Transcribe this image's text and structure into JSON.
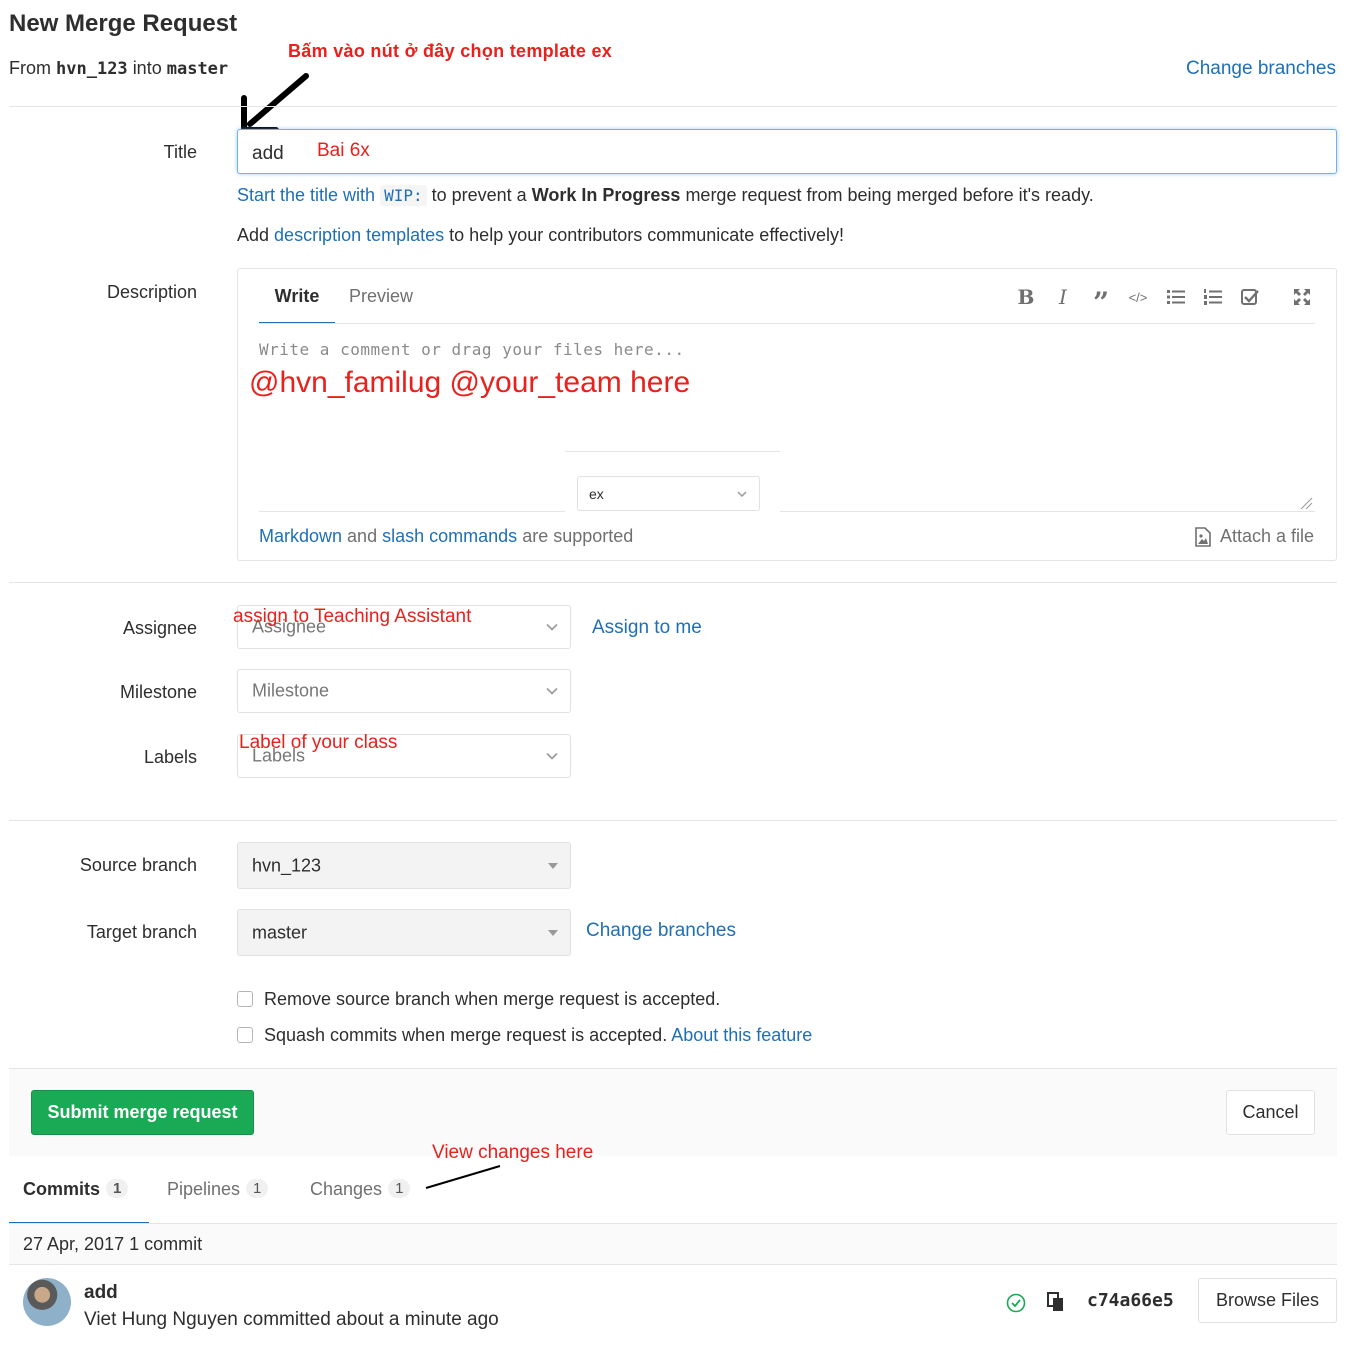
{
  "header": {
    "title": "New Merge Request",
    "from_word": "From",
    "source_branch": "hvn_123",
    "into_word": "into",
    "target_branch": "master",
    "change_branches": "Change branches"
  },
  "annotations": {
    "template_hint": "Bấm vào nút ở đây chọn template ex",
    "title_hint": "Bai 6x",
    "mentions": "@hvn_familug @your_team here",
    "assignee_hint": "assign to Teaching Assistant",
    "labels_hint": "Label of your class",
    "changes_hint": "View changes here"
  },
  "title_field": {
    "label": "Title",
    "value": "add",
    "wip_hint_prefix": "Start the title with",
    "wip_code": "WIP:",
    "wip_hint_mid": "to prevent a",
    "wip_bold": "Work In Progress",
    "wip_hint_suffix": "merge request from being merged before it's ready.",
    "templates_prefix": "Add",
    "templates_link": "description templates",
    "templates_suffix": "to help your contributors communicate effectively!"
  },
  "description": {
    "label": "Description",
    "tab_write": "Write",
    "tab_preview": "Preview",
    "placeholder": "Write a comment or drag your files here...",
    "template_select": "ex",
    "markdown_link": "Markdown",
    "and_word": "and",
    "slash_link": "slash commands",
    "supported": "are supported",
    "attach": "Attach a file",
    "toolbar_icons": [
      "bold-icon",
      "italic-icon",
      "quote-icon",
      "code-icon",
      "bullet-list-icon",
      "numbered-list-icon",
      "task-list-icon",
      "fullscreen-icon"
    ]
  },
  "sidebar_fields": {
    "assignee_label": "Assignee",
    "assignee_placeholder": "Assignee",
    "assign_to_me": "Assign to me",
    "milestone_label": "Milestone",
    "milestone_placeholder": "Milestone",
    "labels_label": "Labels",
    "labels_placeholder": "Labels"
  },
  "branches": {
    "source_label": "Source branch",
    "source_value": "hvn_123",
    "target_label": "Target branch",
    "target_value": "master",
    "change_branches": "Change branches"
  },
  "options": {
    "remove_source": "Remove source branch when merge request is accepted.",
    "squash": "Squash commits when merge request is accepted.",
    "about_feature": "About this feature"
  },
  "actions": {
    "submit": "Submit merge request",
    "cancel": "Cancel"
  },
  "tabs": [
    {
      "label": "Commits",
      "count": "1"
    },
    {
      "label": "Pipelines",
      "count": "1"
    },
    {
      "label": "Changes",
      "count": "1"
    }
  ],
  "commits": {
    "day_header": "27 Apr, 2017 1 commit",
    "items": [
      {
        "title": "add",
        "meta": "Viet Hung Nguyen committed about a minute ago",
        "sha": "c74a66e5",
        "browse": "Browse Files"
      }
    ]
  },
  "colors": {
    "link": "#1f6fb5",
    "annotation": "#e8211d",
    "submit_green": "#1aaa55",
    "focus_border": "#73afea"
  }
}
